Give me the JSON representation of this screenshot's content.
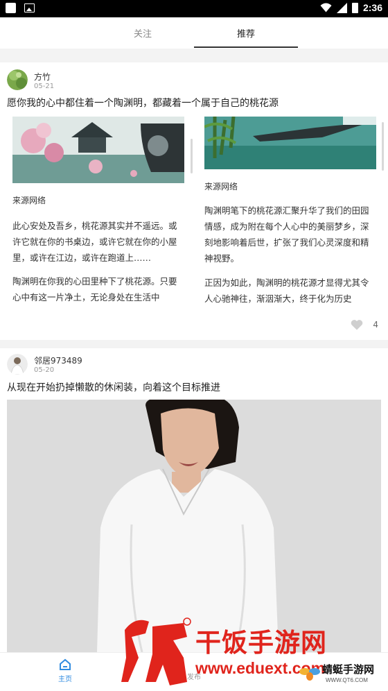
{
  "status_bar": {
    "time": "2:36"
  },
  "tabs": [
    {
      "label": "关注",
      "active": false
    },
    {
      "label": "推荐",
      "active": true
    }
  ],
  "posts": [
    {
      "author": "方竹",
      "date": "05-21",
      "title": "愿你我的心中都住着一个陶渊明，都藏着一个属于自己的桃花源",
      "columns": [
        {
          "source": "来源网络",
          "paragraphs": [
            "此心安处及吾乡，桃花源其实并不遥远。或许它就在你的书桌边，或许它就在你的小屋里，或许在江边，或许在跑道上……",
            "陶渊明在你我的心田里种下了桃花源。只要心中有这一片净土，无论身处在生活中"
          ]
        },
        {
          "source": "来源网络",
          "paragraphs": [
            "陶渊明笔下的桃花源汇聚升华了我们的田园情感，成为附在每个人心中的美丽梦乡，深刻地影响着后世，扩张了我们心灵深度和精神视野。",
            "正因为如此，陶渊明的桃花源才显得尤其令人心驰神往，渐洇渐大，终于化为历史"
          ]
        }
      ],
      "likes": "4"
    },
    {
      "author": "邻居973489",
      "date": "05-20",
      "title": "从现在开始扔掉懒散的休闲装，向着这个目标推进"
    }
  ],
  "bottom_nav": [
    {
      "label": "主页",
      "active": true
    },
    {
      "label": "发布",
      "active": false
    }
  ],
  "watermark": {
    "brand": "干饭手游网",
    "url": "www.eduext.com",
    "secondary": "蜻蜓手游网",
    "secondary_url": "WWW.QT6.COM"
  },
  "colors": {
    "accent": "#2f8be0",
    "watermark_red": "#e0241c"
  }
}
